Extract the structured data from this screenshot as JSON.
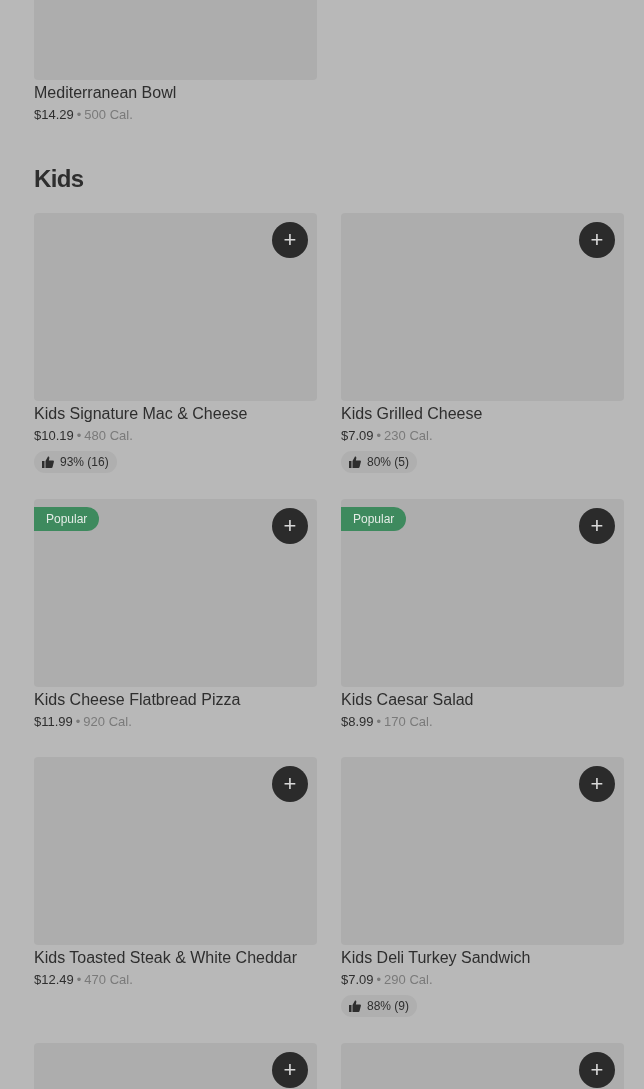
{
  "top_item": {
    "name": "Mediterranean Bowl",
    "price": "$14.29",
    "separator": "•",
    "calories": "500 Cal."
  },
  "section": {
    "title": "Kids",
    "items": [
      {
        "name": "Kids Signature Mac & Cheese",
        "price": "$10.19",
        "separator": "•",
        "calories": "480 Cal.",
        "popular": false,
        "rating": "93% (16)",
        "add": "+"
      },
      {
        "name": "Kids Grilled Cheese",
        "price": "$7.09",
        "separator": "•",
        "calories": "230 Cal.",
        "popular": false,
        "rating": "80% (5)",
        "add": "+"
      },
      {
        "name": "Kids Cheese Flatbread Pizza",
        "price": "$11.99",
        "separator": "•",
        "calories": "920 Cal.",
        "popular": true,
        "badge": "Popular",
        "add": "+"
      },
      {
        "name": "Kids Caesar Salad",
        "price": "$8.99",
        "separator": "•",
        "calories": "170 Cal.",
        "popular": true,
        "badge": "Popular",
        "add": "+"
      },
      {
        "name": "Kids Toasted Steak & White Cheddar",
        "price": "$12.49",
        "separator": "•",
        "calories": "470 Cal.",
        "popular": false,
        "add": "+"
      },
      {
        "name": "Kids Deli Turkey Sandwich",
        "price": "$7.09",
        "separator": "•",
        "calories": "290 Cal.",
        "popular": false,
        "rating": "88% (9)",
        "add": "+"
      },
      {
        "popular": false,
        "add": "+"
      },
      {
        "popular": false,
        "add": "+"
      }
    ]
  }
}
